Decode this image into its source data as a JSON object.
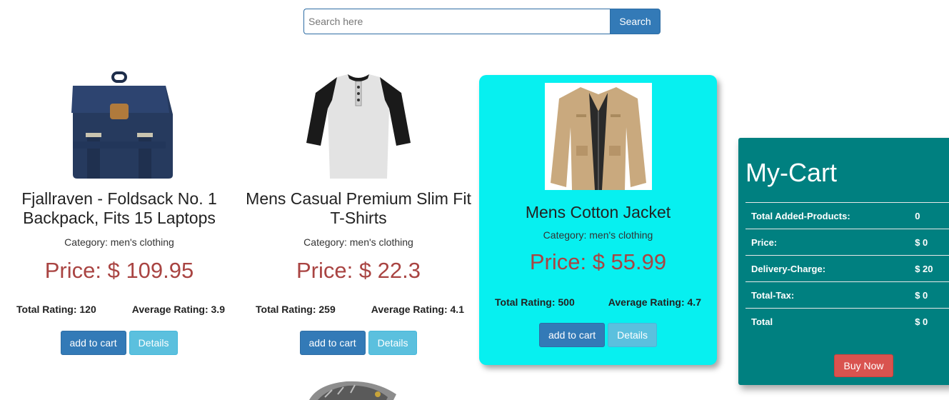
{
  "search": {
    "placeholder": "Search here",
    "button_label": "Search"
  },
  "products": [
    {
      "title": "Fjallraven - Foldsack No. 1 Backpack, Fits 15 Laptops",
      "category": "Category: men's clothing",
      "price": "Price: $ 109.95",
      "total_rating": "Total Rating: 120",
      "average_rating": "Average Rating: 3.9",
      "add_label": "add to cart",
      "details_label": "Details",
      "icon": "backpack-image"
    },
    {
      "title": "Mens Casual Premium Slim Fit T-Shirts",
      "category": "Category: men's clothing",
      "price": "Price: $ 22.3",
      "total_rating": "Total Rating: 259",
      "average_rating": "Average Rating: 4.1",
      "add_label": "add to cart",
      "details_label": "Details",
      "icon": "tshirt-image"
    },
    {
      "title": "Mens Cotton Jacket",
      "category": "Category: men's clothing",
      "price": "Price: $ 55.99",
      "total_rating": "Total Rating: 500",
      "average_rating": "Average Rating: 4.7",
      "add_label": "add to cart",
      "details_label": "Details",
      "icon": "jacket-image"
    }
  ],
  "cart": {
    "title": "My-Cart",
    "rows": [
      {
        "label": "Total Added-Products:",
        "value": "0"
      },
      {
        "label": "Price:",
        "value": "$ 0"
      },
      {
        "label": "Delivery-Charge:",
        "value": "$ 20"
      },
      {
        "label": "Total-Tax:",
        "value": "$ 0"
      },
      {
        "label": "Total",
        "value": "$ 0"
      }
    ],
    "buy_label": "Buy Now"
  },
  "colors": {
    "primary": "#337ab7",
    "info": "#5bc0de",
    "danger": "#d9534f",
    "price": "#a94442",
    "highlight_card": "#07f0f0",
    "cart_bg": "#008080"
  }
}
